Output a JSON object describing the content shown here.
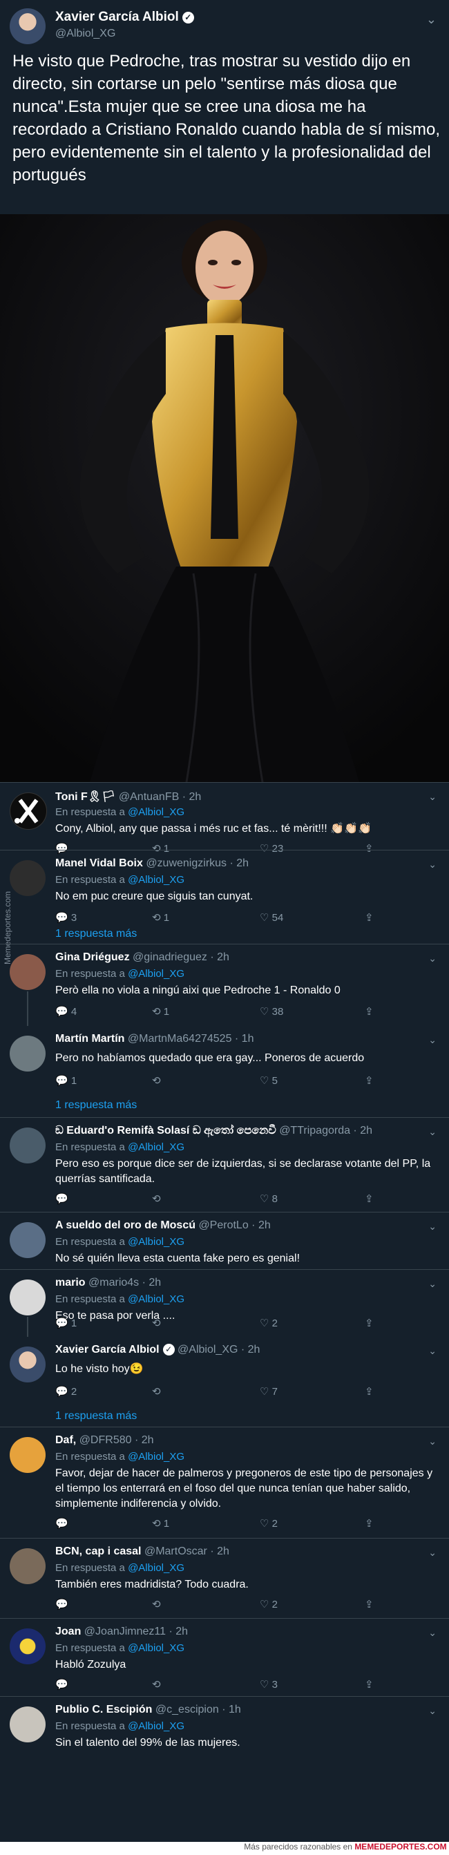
{
  "tweet": {
    "author_name": "Xavier García Albiol",
    "author_handle": "@Albiol_XG",
    "text": "He visto que Pedroche, tras mostrar su vestido dijo en directo, sin cortarse un pelo \"sentirse más diosa que nunca\".Esta mujer que se cree una diosa me ha recordado a Cristiano Ronaldo cuando habla de sí mismo, pero evidentemente sin el talento y la profesionalidad del portugués"
  },
  "watermark": "Memedeportes.com",
  "replies": [
    {
      "name": "Toni F🎗🏳",
      "handle": "@AntuanFB · 2h",
      "reply_prefix": "En respuesta a",
      "reply_to": "@Albiol_XG",
      "text": "Cony, Albiol, any que passa i més ruc et fas... té mèrit!!! 👏🏻👏🏻👏🏻",
      "replies": "",
      "retweets": "1",
      "likes": "23"
    },
    {
      "name": "Manel Vidal Boix",
      "handle": "@zuwenigzirkus · 2h",
      "reply_prefix": "En respuesta a",
      "reply_to": "@Albiol_XG",
      "text": "No em puc creure que siguis tan cunyat.",
      "replies": "3",
      "retweets": "1",
      "likes": "54",
      "more": "1 respuesta más"
    },
    {
      "name": "Gina Driéguez",
      "handle": "@ginadrieguez · 2h",
      "reply_prefix": "En respuesta a",
      "reply_to": "@Albiol_XG",
      "text": "Però ella no viola a ningú aixi que Pedroche 1 - Ronaldo 0",
      "replies": "4",
      "retweets": "1",
      "likes": "38"
    },
    {
      "name": "Martín Martín",
      "handle": "@MartnMa64274525 · 1h",
      "reply_prefix": "",
      "reply_to": "",
      "text": "Pero no habíamos quedado que era gay... Poneros de acuerdo",
      "replies": "1",
      "retweets": "",
      "likes": "5",
      "more": "1 respuesta más"
    },
    {
      "name": "ඞ Eduard'o Remifà Solasí ඞ ඇතෝ පෙනෙවී",
      "handle": "@TTripagorda · 2h",
      "reply_prefix": "En respuesta a",
      "reply_to": "@Albiol_XG",
      "text": "Pero eso es porque dice ser de izquierdas, si se declarase votante del PP, la querrías santificada.",
      "replies": "",
      "retweets": "",
      "likes": "8"
    },
    {
      "name": "A sueldo del oro de Moscú",
      "handle": "@PerotLo · 2h",
      "reply_prefix": "En respuesta a",
      "reply_to": "@Albiol_XG",
      "text": "No sé quién lleva esta cuenta fake pero es genial!",
      "replies": "",
      "retweets": "",
      "likes": ""
    },
    {
      "name": "mario",
      "handle": "@mario4s · 2h",
      "reply_prefix": "En respuesta a",
      "reply_to": "@Albiol_XG",
      "text": "Eso te pasa por verla ....",
      "replies": "1",
      "retweets": "",
      "likes": "2"
    },
    {
      "name": "Xavier García Albiol",
      "handle": "@Albiol_XG · 2h",
      "reply_prefix": "",
      "reply_to": "",
      "text": "Lo he visto hoy😉",
      "replies": "2",
      "retweets": "",
      "likes": "7",
      "more": "1 respuesta más"
    },
    {
      "name": "Daf,",
      "handle": "@DFR580 · 2h",
      "reply_prefix": "En respuesta a",
      "reply_to": "@Albiol_XG",
      "text": "Favor, dejar de hacer de palmeros y pregoneros de este tipo de personajes y el tiempo los enterrará en el foso del que nunca tenían que haber salido, simplemente indiferencia y olvido.",
      "replies": "",
      "retweets": "1",
      "likes": "2"
    },
    {
      "name": "BCN, cap i casal",
      "handle": "@MartOscar · 2h",
      "reply_prefix": "En respuesta a",
      "reply_to": "@Albiol_XG",
      "text": "También eres madridista?  Todo cuadra.",
      "replies": "",
      "retweets": "",
      "likes": "2"
    },
    {
      "name": "Joan",
      "handle": "@JoanJimnez11 · 2h",
      "reply_prefix": "En respuesta a",
      "reply_to": "@Albiol_XG",
      "text": "Habló Zozulya",
      "replies": "",
      "retweets": "",
      "likes": "3"
    },
    {
      "name": "Publio C. Escipión",
      "handle": "@c_escipion · 1h",
      "reply_prefix": "En respuesta a",
      "reply_to": "@Albiol_XG",
      "text": "Sin el talento del 99% de las mujeres.",
      "replies": "",
      "retweets": "",
      "likes": ""
    }
  ],
  "footer": {
    "prefix": "Más parecidos razonables en",
    "brand": "MEMEDEPORTES.COM"
  },
  "colors": {
    "background": "#15202b",
    "link": "#1da1f2",
    "muted": "#8899a6"
  }
}
